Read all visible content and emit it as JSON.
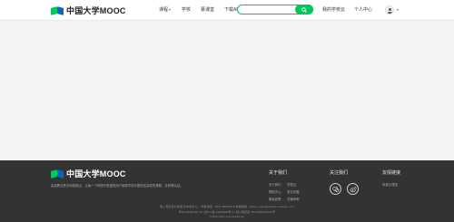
{
  "header": {
    "logo_text": "中国大学MOOC",
    "nav": [
      {
        "label": "课程",
        "has_caret": true
      },
      {
        "label": "学校"
      },
      {
        "label": "慕课堂"
      },
      {
        "label": "下载APP"
      }
    ],
    "search": {
      "value": "",
      "placeholder": ""
    },
    "user_links": [
      "我的学校云",
      "个人中心"
    ],
    "colors": {
      "brand_green": "#00c758",
      "brand_blue": "#0a65c2"
    }
  },
  "icons": {
    "search": "search-icon",
    "avatar": "avatar-icon",
    "wechat": "wechat-icon",
    "weibo": "weibo-icon"
  },
  "footer": {
    "logo_text": "中国大学MOOC",
    "description": "由高教社携手网易推出，让每一个有提升愿望的用户能够学到中国知名高校的课程，并获得认证。",
    "about": {
      "title": "关于我们",
      "links": [
        "关于我们",
        "学校云",
        "帮助中心",
        "常见问题",
        "隐私政策",
        "法律声明"
      ]
    },
    "follow": {
      "title": "关注我们"
    },
    "friends": {
      "title": "友情链接",
      "links": [
        "网易云课堂"
      ]
    },
    "copyright_lines": [
      "网上有害信息举报(涉未成年人)：举报电话：0571-89853516  举报邮箱：jubao_online@service.netease.com",
      "粤B2-20090191-18 | 浙ICP备 10200680号-3 | 浙公网安备 33010802010016号",
      "©2014-2021 icourse163.org"
    ]
  }
}
